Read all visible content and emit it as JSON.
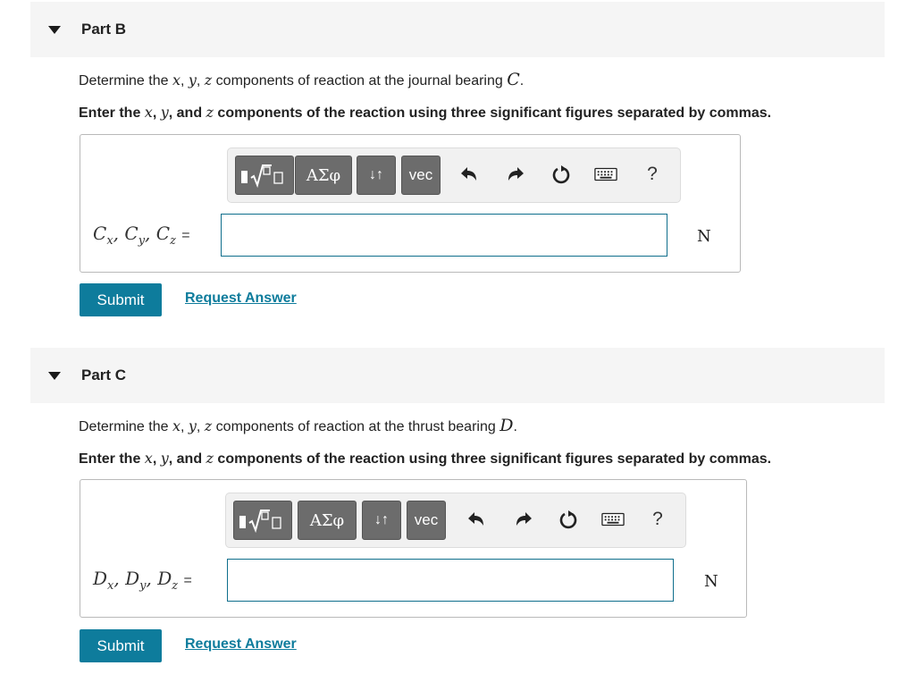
{
  "parts": [
    {
      "title": "Part B",
      "prompt_prefix": "Determine the ",
      "var_x": "x",
      "sep1": ", ",
      "var_y": "y",
      "sep2": ", ",
      "var_z": "z",
      "prompt_middle": " components of reaction at the journal bearing ",
      "point": "C",
      "prompt_end": ".",
      "instr_prefix": "Enter the ",
      "instr_x": "x",
      "instr_sep1": ", ",
      "instr_y": "y",
      "instr_sep2": ", and ",
      "instr_z": "z",
      "instr_suffix": " components of the reaction using three significant figures separated by commas.",
      "answer_sym": "C",
      "sub_x": "x",
      "sub_y": "y",
      "sub_z": "z",
      "input_value": "",
      "unit": "N",
      "submit_label": "Submit",
      "request_label": "Request Answer"
    },
    {
      "title": "Part C",
      "prompt_prefix": "Determine the ",
      "var_x": "x",
      "sep1": ", ",
      "var_y": "y",
      "sep2": ", ",
      "var_z": "z",
      "prompt_middle": " components of reaction at the thrust bearing ",
      "point": "D",
      "prompt_end": ".",
      "instr_prefix": "Enter the ",
      "instr_x": "x",
      "instr_sep1": ", ",
      "instr_y": "y",
      "instr_sep2": ", and ",
      "instr_z": "z",
      "instr_suffix": " components of the reaction using three significant figures separated by commas.",
      "answer_sym": "D",
      "sub_x": "x",
      "sub_y": "y",
      "sub_z": "z",
      "input_value": "",
      "unit": "N",
      "submit_label": "Submit",
      "request_label": "Request Answer"
    }
  ],
  "toolbar": {
    "greek_label": "ΑΣφ",
    "arrows_label": "↓↑",
    "vec_label": "vec",
    "help_label": "?"
  },
  "eq_sign": "=",
  "comma": ",",
  "icons": {
    "caret": "caret-down-icon",
    "templates": "templates-icon",
    "undo": "undo-icon",
    "redo": "redo-icon",
    "reset": "reset-icon",
    "keyboard": "keyboard-icon"
  },
  "colors": {
    "accent": "#0e7c9c",
    "header_bg": "#f5f5f5",
    "toolbar_button": "#6c6c6c"
  }
}
